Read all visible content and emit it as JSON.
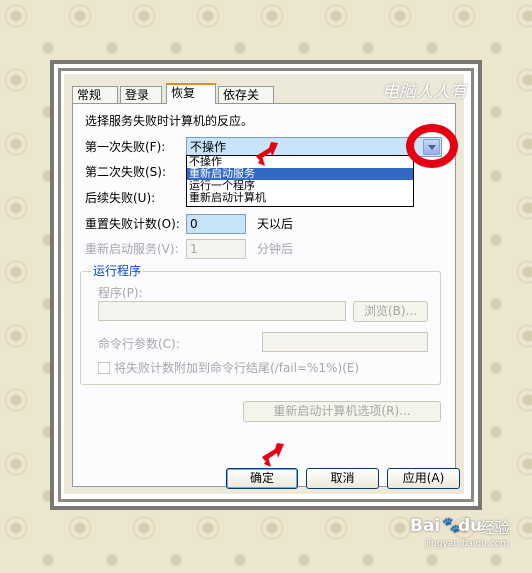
{
  "tabs": [
    "常规",
    "登录",
    "恢复",
    "依存关系"
  ],
  "active_tab": "恢复",
  "watermark": "电脑人人有",
  "instruction": "选择服务失败时计算机的反应。",
  "first_failure": {
    "label": "第一次失败(F):",
    "value": "不操作"
  },
  "second_failure": {
    "label": "第二次失败(S):"
  },
  "subsequent_failure": {
    "label": "后续失败(U):"
  },
  "dropdown_options": [
    "不操作",
    "重新启动服务",
    "运行一个程序",
    "重新启动计算机"
  ],
  "dropdown_selected_index": 1,
  "reset_count": {
    "label": "重置失败计数(O):",
    "value": "0",
    "unit": "天以后"
  },
  "restart_service": {
    "label": "重新启动服务(V):",
    "value": "1",
    "unit": "分钟后"
  },
  "run_program": {
    "group_title": "运行程序",
    "program_label": "程序(P):",
    "browse_label": "浏览(B)...",
    "args_label": "命令行参数(C):",
    "append_label": "将失败计数附加到命令行结尾(/fail=%1%)(E)"
  },
  "restart_options_label": "重新启动计算机选项(R)...",
  "buttons": {
    "ok": "确定",
    "cancel": "取消",
    "apply": "应用(A)"
  },
  "colors": {
    "highlight": "#e60012",
    "selection": "#316ac5"
  },
  "baidu": {
    "logo": "Bai",
    "paw": "🐾",
    "du": "du",
    "jingyan": "经验",
    "url": "jingyan.baidu.com"
  }
}
